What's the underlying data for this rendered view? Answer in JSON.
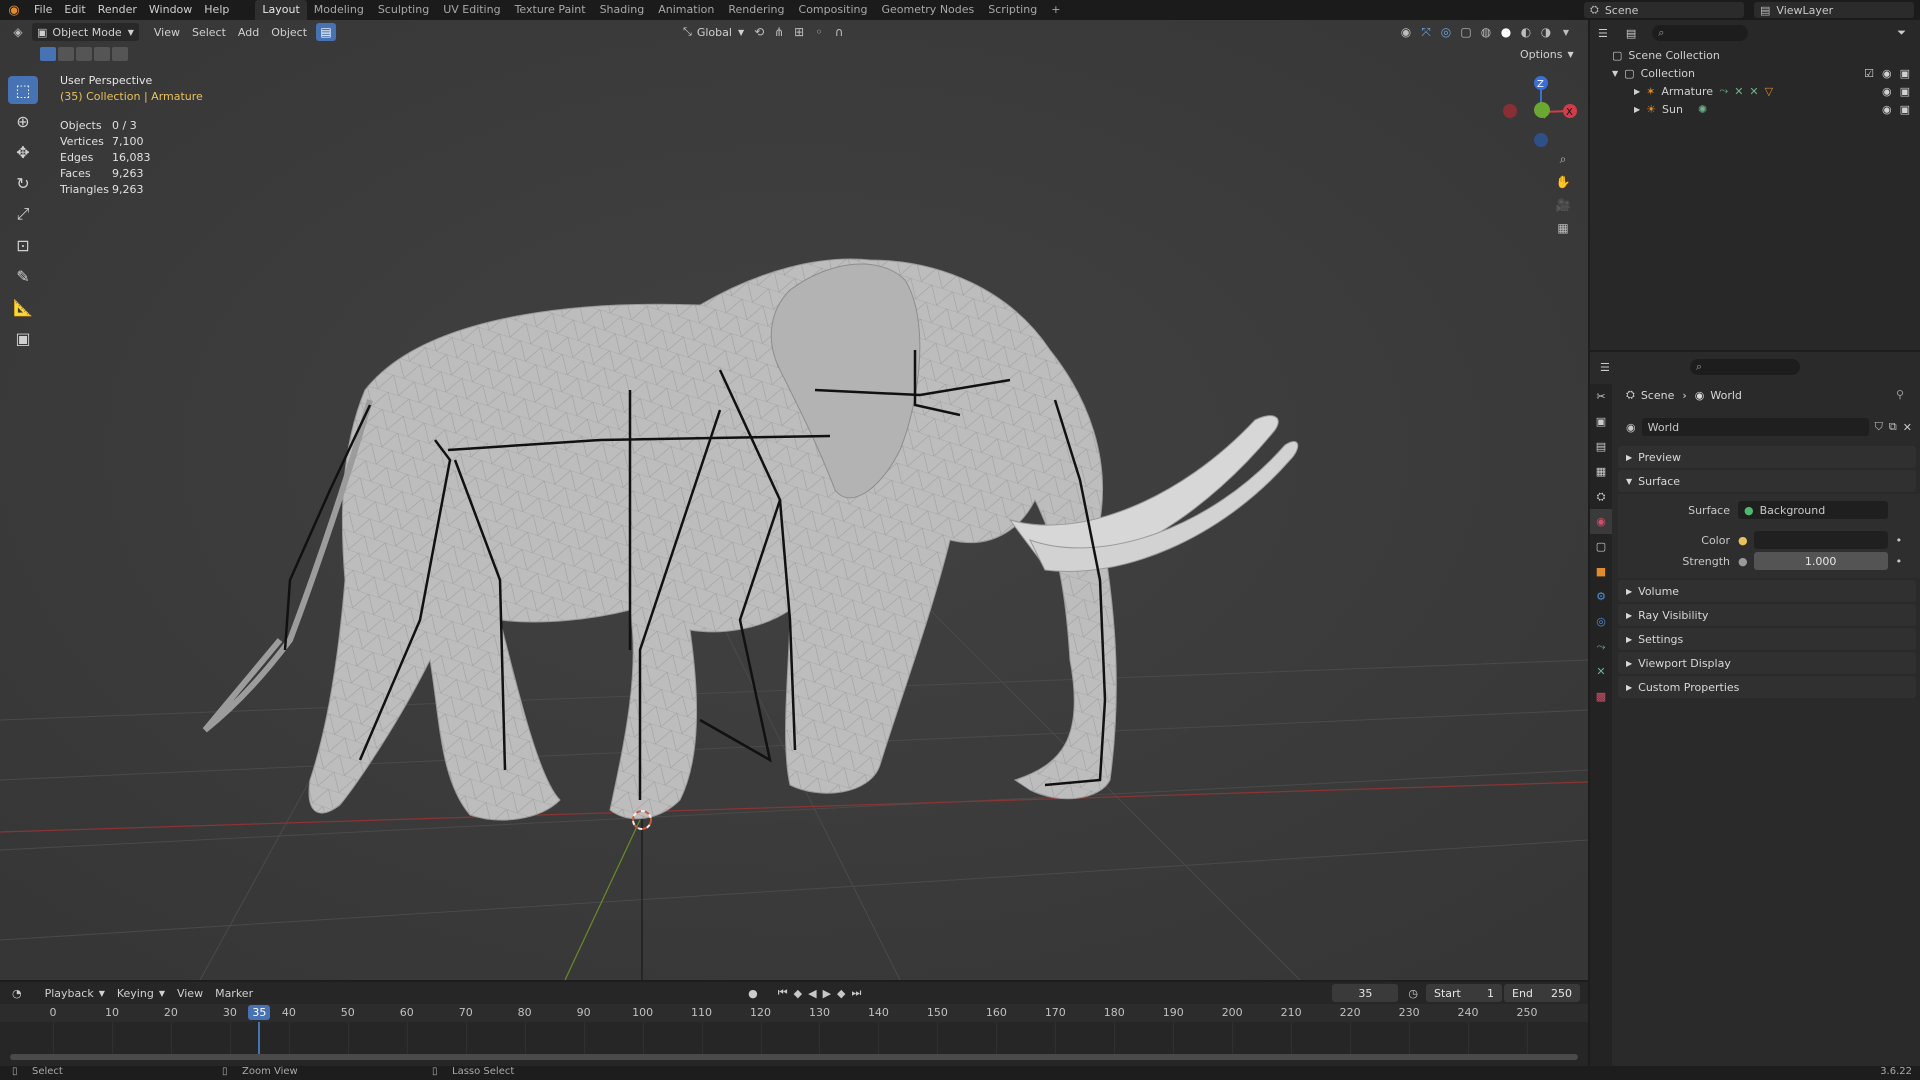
{
  "menu": [
    "File",
    "Edit",
    "Render",
    "Window",
    "Help"
  ],
  "workspaces": [
    {
      "label": "Layout",
      "active": true
    },
    {
      "label": "Modeling",
      "active": false
    },
    {
      "label": "Sculpting",
      "active": false
    },
    {
      "label": "UV Editing",
      "active": false
    },
    {
      "label": "Texture Paint",
      "active": false
    },
    {
      "label": "Shading",
      "active": false
    },
    {
      "label": "Animation",
      "active": false
    },
    {
      "label": "Rendering",
      "active": false
    },
    {
      "label": "Compositing",
      "active": false
    },
    {
      "label": "Geometry Nodes",
      "active": false
    },
    {
      "label": "Scripting",
      "active": false
    }
  ],
  "top_right": {
    "scene": "Scene",
    "view_layer": "ViewLayer"
  },
  "viewport_header": {
    "mode": "Object Mode",
    "menus": [
      "View",
      "Select",
      "Add",
      "Object"
    ],
    "orientation": "Global",
    "options": "Options"
  },
  "overlay": {
    "view_name": "User Perspective",
    "collection_line": "(35) Collection | Armature",
    "stats": [
      {
        "label": "Objects",
        "value": "0 / 3"
      },
      {
        "label": "Vertices",
        "value": "7,100"
      },
      {
        "label": "Edges",
        "value": "16,083"
      },
      {
        "label": "Faces",
        "value": "9,263"
      },
      {
        "label": "Triangles",
        "value": "9,263"
      }
    ]
  },
  "outliner": {
    "root": "Scene Collection",
    "collection": "Collection",
    "items": [
      "Armature",
      "Sun"
    ]
  },
  "properties": {
    "breadcrumb_scene": "Scene",
    "breadcrumb_world": "World",
    "world_name": "World",
    "panels_top": [
      "Preview",
      "Surface"
    ],
    "surface_label": "Surface",
    "surface_value": "Background",
    "color_label": "Color",
    "strength_label": "Strength",
    "strength_value": "1.000",
    "panels_bottom": [
      "Volume",
      "Ray Visibility",
      "Settings",
      "Viewport Display",
      "Custom Properties"
    ]
  },
  "timeline": {
    "menus": [
      "Playback",
      "Keying",
      "View",
      "Marker"
    ],
    "current_frame": "35",
    "start_label": "Start",
    "start_value": "1",
    "end_label": "End",
    "end_value": "250",
    "ticks": [
      "0",
      "10",
      "20",
      "30",
      "40",
      "50",
      "60",
      "70",
      "80",
      "90",
      "100",
      "110",
      "120",
      "130",
      "140",
      "150",
      "160",
      "170",
      "180",
      "190",
      "200",
      "210",
      "220",
      "230",
      "240",
      "250"
    ],
    "current_frame_value": 35,
    "frame_end": 250
  },
  "statusbar": {
    "select": "Select",
    "zoom": "Zoom View",
    "lasso": "Lasso Select",
    "version": "3.6.22"
  }
}
